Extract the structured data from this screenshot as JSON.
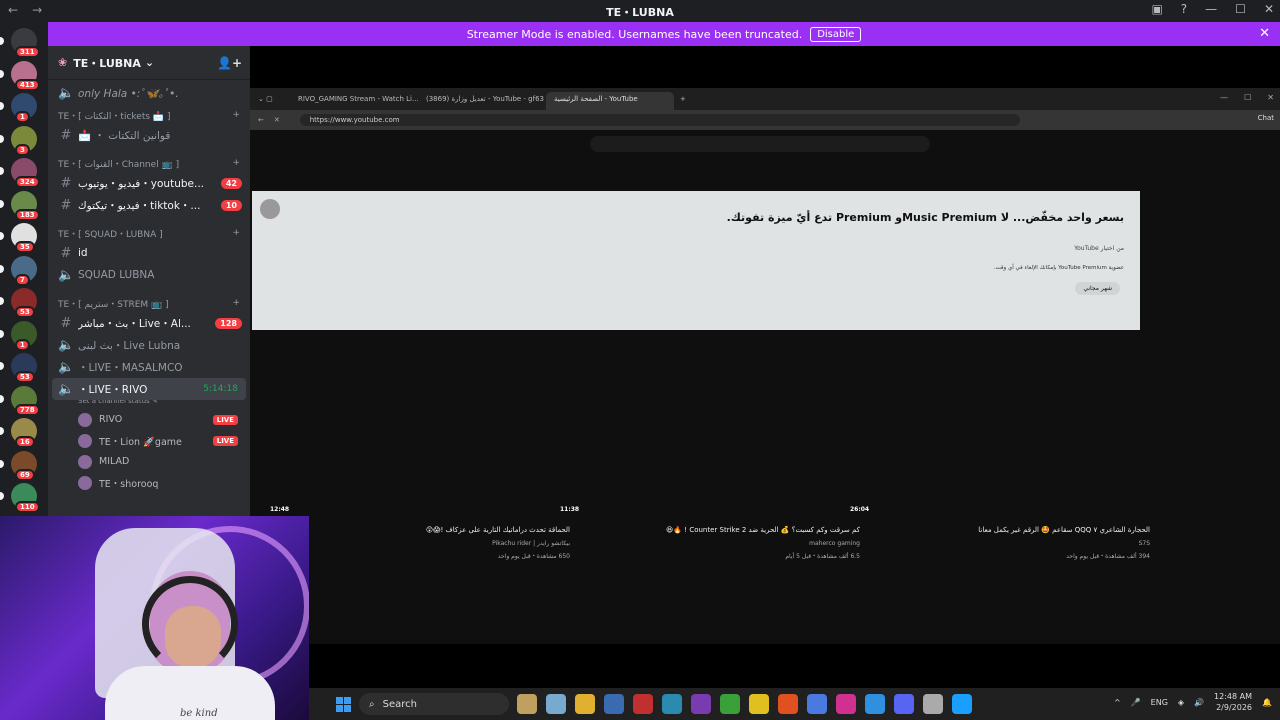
{
  "window": {
    "title": "TE・LUBNA",
    "back": "←",
    "fwd": "→"
  },
  "banner": {
    "text": "Streamer Mode is enabled. Usernames have been truncated.",
    "button": "Disable",
    "close": "✕"
  },
  "servers": [
    {
      "badge": "311",
      "color": "#3a3b41"
    },
    {
      "badge": "413",
      "color": "#b9708e"
    },
    {
      "badge": "1",
      "color": "#2f4a6e"
    },
    {
      "badge": "3",
      "color": "#7a8a3a"
    },
    {
      "badge": "324",
      "color": "#8a4a6a"
    },
    {
      "badge": "183",
      "color": "#6a8a4a"
    },
    {
      "badge": "35",
      "color": "#e0e0e0"
    },
    {
      "badge": "7",
      "color": "#4a6a8a"
    },
    {
      "badge": "53",
      "color": "#8a2a2a"
    },
    {
      "badge": "1",
      "color": "#3a5a2a"
    },
    {
      "badge": "53",
      "color": "#2a3a5a"
    },
    {
      "badge": "778",
      "color": "#5a7a3a"
    },
    {
      "badge": "16",
      "color": "#9a8a4a"
    },
    {
      "badge": "69",
      "color": "#7a4a2a"
    },
    {
      "badge": "110",
      "color": "#3a8a5a"
    }
  ],
  "channels": {
    "server_name": "TE・LUBNA",
    "top_item": "only Hala •:ﾟ🦋｡ﾟ•.",
    "cat1": "TE・[ التكتات・tickets 📩 ]",
    "tickets": "📩 ・ قوانين التكتات",
    "cat2": "TE・[ القنوات・Channel 📺 ]",
    "yt": "فيديو・يوتيوب・youtube...",
    "yt_count": "42",
    "tt": "فيديو・تيكتوك・tiktok・...",
    "tt_count": "10",
    "cat3": "TE・[ SQUAD・LUBNA ]",
    "id": "id",
    "squad": "SQUAD LUBNA",
    "cat4": "TE・[ ستريم・STREM 📺 ]",
    "live_al": "بث・مباشر・Live・Al...",
    "live_al_count": "128",
    "live_lubna": "بث لبنى・Live Lubna",
    "live_masal": "・LIVE・MASALMCO",
    "live_rivo": "・LIVE・RIVO",
    "live_rivo_time": "5:14:18",
    "status": "Set a channel status ✎",
    "users": [
      {
        "name": "RIVO",
        "live": "LIVE"
      },
      {
        "name": "TE・Lion 🚀game",
        "live": "LIVE"
      },
      {
        "name": "MILAD",
        "live": ""
      },
      {
        "name": "TE・shorooq",
        "live": ""
      }
    ]
  },
  "browser": {
    "tabs": [
      "RIVO_GAMING Stream - Watch Li...",
      "(3869) تعديل وزارة - YouTube - gf63",
      "الصفحة الرئيسية - YouTube"
    ],
    "url": "https://www.youtube.com",
    "chat": "Chat"
  },
  "ad": {
    "title": "بسعر واحد مخفّض... لا Music Premiumو Premium تدع أيّ ميزة تفوتك.",
    "sub": "من اختيار YouTube",
    "desc": "عضوية YouTube Premium بإمكانك الإلغاء في أي وقت.",
    "cta": "شهر مجاني"
  },
  "videos": [
    {
      "dur": "12:48",
      "title": "الحماقة تحدث دراماتيك التارية على عزكاف !😱😲",
      "channel": "بيكاتشو رايدر | Pikachu rider",
      "meta": "650 مشاهدة・قبل يوم واحد"
    },
    {
      "dur": "11:38",
      "title": "كم سرقت وكم كسبت؟ 💰 الحرية ضد Counter Strike 2 ! 🔥😆",
      "channel": "maherco gaming",
      "meta": "6.5 ألف مشاهدة・قبل 5 أيام"
    },
    {
      "dur": "26:04",
      "title": "الحجارة الشاعري QQQ ۷ سقاعم 🤩 الرقم غير يكمل معانا",
      "channel": "S7S",
      "meta": "394 ألف مشاهدة・قبل يوم واحد"
    }
  ],
  "cam": {
    "shirt": "be kind"
  },
  "taskbar": {
    "search": "Search",
    "lang": "ENG",
    "time": "12:48 AM",
    "date": "2/9/2026",
    "apps": [
      "#c0a060",
      "#7ac",
      "#e0b030",
      "#3a6ab0",
      "#c03030",
      "#2a8ab0",
      "#7a3ab0",
      "#3aa03a",
      "#e0c020",
      "#e05020",
      "#4a7ae0",
      "#d03090",
      "#3090e0",
      "#5865f2",
      "#aaaaaa",
      "#1a9fff"
    ]
  }
}
